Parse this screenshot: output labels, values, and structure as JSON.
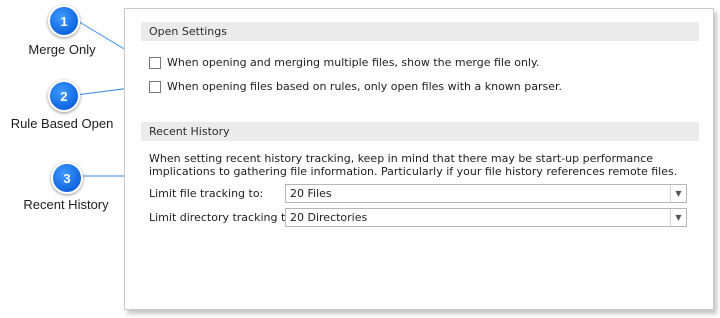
{
  "callouts": [
    {
      "number": "1",
      "label": "Merge Only"
    },
    {
      "number": "2",
      "label": "Rule Based Open"
    },
    {
      "number": "3",
      "label": "Recent History"
    }
  ],
  "open_settings": {
    "title": "Open Settings",
    "options": [
      {
        "label": "When opening and merging multiple files, show the merge file only.",
        "checked": false
      },
      {
        "label": "When opening files based on rules, only open files with a known parser.",
        "checked": false
      }
    ]
  },
  "recent_history": {
    "title": "Recent History",
    "description": "When setting recent history tracking, keep in mind that there may be start-up performance implications to gathering file information.  Particularly if your file history references remote files.",
    "file_tracking": {
      "label": "Limit file tracking to:",
      "value": "20 Files"
    },
    "directory_tracking": {
      "label": "Limit directory tracking to:",
      "value": "20 Directories"
    }
  },
  "colors": {
    "accent": "#1166e0",
    "header_bg": "#ebebeb"
  }
}
